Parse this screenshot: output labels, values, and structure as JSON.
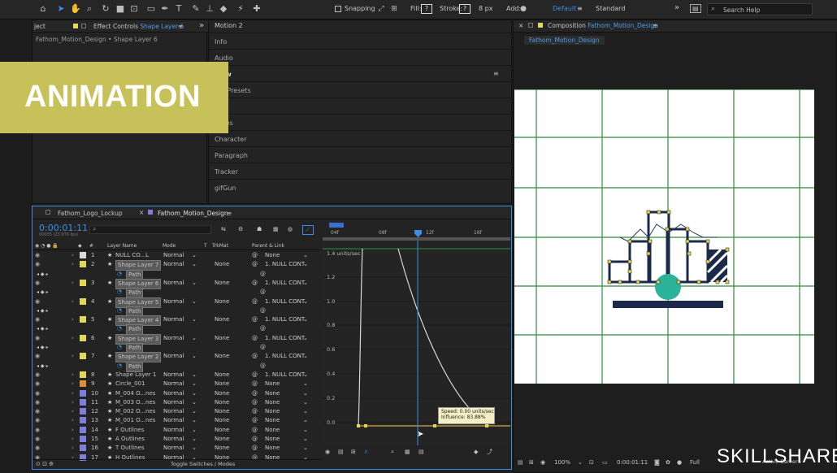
{
  "toolbar": {
    "snapping_label": "Snapping",
    "fill_label": "Fill:",
    "fill_value": "?",
    "stroke_label": "Stroke:",
    "stroke_value": "?",
    "stroke_px": "8 px",
    "add_label": "Add:",
    "workspace_default": "Default",
    "workspace_standard": "Standard",
    "search_placeholder": "Search Help"
  },
  "left_panel": {
    "project_tab": "ject",
    "effect_controls_tab_prefix": "Effect Controls",
    "effect_controls_tab_layer": "Shape Layer 6",
    "breadcrumb": "Fathom_Motion_Design • Shape Layer 6"
  },
  "mid_panel": {
    "items": [
      "Motion 2",
      "Info",
      "Audio",
      "view",
      "s & Presets",
      "raries",
      "Character",
      "Paragraph",
      "Tracker",
      "gifGun"
    ]
  },
  "comp_panel": {
    "tab_prefix": "Composition",
    "tab_name": "Fathom_Motion_Design",
    "subtab": "Fathom_Motion_Design",
    "zoom": "100%",
    "timecode": "0:00:01:11",
    "resolution": "Full",
    "camera": "Active Camera"
  },
  "overlay": {
    "banner": "ANIMATION",
    "brand": "SKILLSHARE"
  },
  "timeline": {
    "tab_logo": "Fathom_Logo_Lockup",
    "tab_main": "Fathom_Motion_Design",
    "timecode": "0:00:01:11",
    "frames": "00035 (23.976 fps)",
    "col_layer_name": "Layer Name",
    "col_mode": "Mode",
    "col_t": "T",
    "col_trkmat": "TrkMat",
    "col_parent": "Parent & Link",
    "ruler_labels": [
      "04f",
      "08f",
      "12f",
      "16f"
    ],
    "toggle_label": "Toggle Switches / Modes",
    "graph_unit": "1.4 units/sec",
    "graph_ticks": [
      "1.2",
      "1.0",
      "0.8",
      "0.6",
      "0.4",
      "0.2",
      "0.0"
    ],
    "tooltip_speed": "Speed: 0.00 units/sec",
    "tooltip_influence": "Influence: 83.88%",
    "path_label": "Path",
    "layers": [
      {
        "num": "1",
        "name": "NULL CO...L",
        "mode": "Normal",
        "trkmat": "",
        "parent": "None",
        "color": "#d9d9d9",
        "selected": false
      },
      {
        "num": "2",
        "name": "Shape Layer 7",
        "mode": "Normal",
        "trkmat": "None",
        "parent": "1. NULL CONT",
        "color": "#e0d85a",
        "selected": true
      },
      {
        "num": "3",
        "name": "Shape Layer 6",
        "mode": "Normal",
        "trkmat": "None",
        "parent": "1. NULL CONT",
        "color": "#e0d85a",
        "selected": true
      },
      {
        "num": "4",
        "name": "Shape Layer 5",
        "mode": "Normal",
        "trkmat": "None",
        "parent": "1. NULL CONT",
        "color": "#e0d85a",
        "selected": true
      },
      {
        "num": "5",
        "name": "Shape Layer 4",
        "mode": "Normal",
        "trkmat": "None",
        "parent": "1. NULL CONT",
        "color": "#e0d85a",
        "selected": true
      },
      {
        "num": "6",
        "name": "Shape Layer 3",
        "mode": "Normal",
        "trkmat": "None",
        "parent": "1. NULL CONT",
        "color": "#e0d85a",
        "selected": true
      },
      {
        "num": "7",
        "name": "Shape Layer 2",
        "mode": "Normal",
        "trkmat": "None",
        "parent": "1. NULL CONT",
        "color": "#e0d85a",
        "selected": true
      },
      {
        "num": "8",
        "name": "Shape Layer 1",
        "mode": "Normal",
        "trkmat": "None",
        "parent": "1. NULL CONT",
        "color": "#e0d85a",
        "selected": false
      },
      {
        "num": "9",
        "name": "Circle_001",
        "mode": "Normal",
        "trkmat": "None",
        "parent": "None",
        "color": "#e08c3c",
        "selected": false
      },
      {
        "num": "10",
        "name": "M_004 O...nes",
        "mode": "Normal",
        "trkmat": "None",
        "parent": "None",
        "color": "#7f7fd9",
        "selected": false
      },
      {
        "num": "11",
        "name": "M_003 O...nes",
        "mode": "Normal",
        "trkmat": "None",
        "parent": "None",
        "color": "#7f7fd9",
        "selected": false
      },
      {
        "num": "12",
        "name": "M_002 O...nes",
        "mode": "Normal",
        "trkmat": "None",
        "parent": "None",
        "color": "#7f7fd9",
        "selected": false
      },
      {
        "num": "13",
        "name": "M_001 O...nes",
        "mode": "Normal",
        "trkmat": "None",
        "parent": "None",
        "color": "#7f7fd9",
        "selected": false
      },
      {
        "num": "14",
        "name": "F Outlines",
        "mode": "Normal",
        "trkmat": "None",
        "parent": "None",
        "color": "#7f7fd9",
        "selected": false
      },
      {
        "num": "15",
        "name": "A Outlines",
        "mode": "Normal",
        "trkmat": "None",
        "parent": "None",
        "color": "#7f7fd9",
        "selected": false
      },
      {
        "num": "16",
        "name": "T Outlines",
        "mode": "Normal",
        "trkmat": "None",
        "parent": "None",
        "color": "#7f7fd9",
        "selected": false
      },
      {
        "num": "17",
        "name": "H Outlines",
        "mode": "Normal",
        "trkmat": "None",
        "parent": "None",
        "color": "#7f7fd9",
        "selected": false
      }
    ]
  }
}
